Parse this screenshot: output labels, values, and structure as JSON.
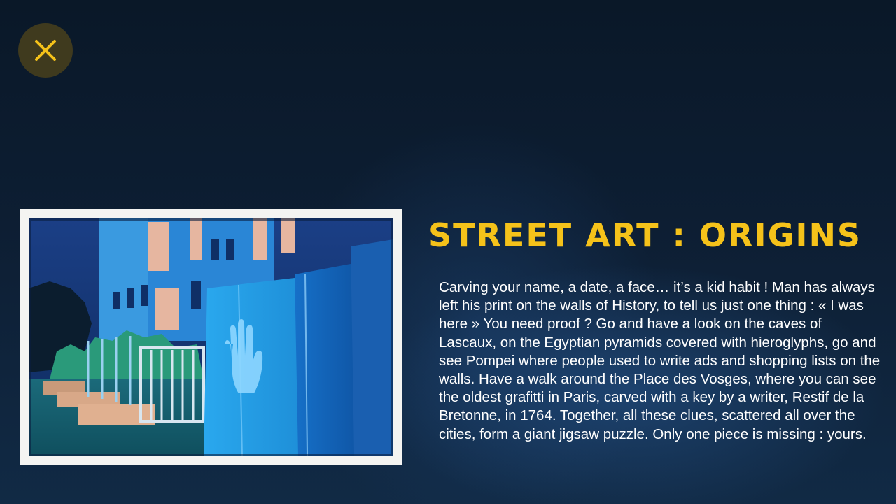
{
  "close_button": {
    "icon": "close-icon",
    "icon_color": "#f5c21a",
    "background": "#3f3a1e"
  },
  "article": {
    "title": "STREET ART : ORIGINS",
    "title_color": "#f5c21a",
    "body": "Carving your name, a date, a face… it’s a kid habit ! Man has always left his print on the walls of History, to tell us just one thing : « I was here » You need proof ? Go and have a look on the caves of Lascaux, on the Egyptian pyramids covered with hieroglyphs, go and see Pompei where people used to write ads and shopping lists on the walls. Have a walk around the Place des Vosges, where you can see the oldest grafitti in Paris, carved with a key by a writer, Restif de la Bretonne, in 1764. Together, all these clues, scattered all over the cities, form a giant jigsaw puzzle. Only one piece is missing : yours."
  },
  "illustration": {
    "subject": "blue street scene with a handprint on a wall",
    "frame_color": "#f4f4f2"
  }
}
